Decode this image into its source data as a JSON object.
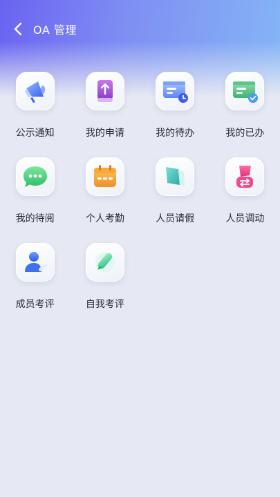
{
  "header": {
    "title": "OA 管理"
  },
  "menu": [
    {
      "label": "公示通知",
      "icon": "megaphone-icon"
    },
    {
      "label": "我的申请",
      "icon": "upload-book-icon"
    },
    {
      "label": "我的待办",
      "icon": "pending-tasks-icon"
    },
    {
      "label": "我的已办",
      "icon": "done-tasks-icon"
    },
    {
      "label": "我的待阅",
      "icon": "chat-bubble-icon"
    },
    {
      "label": "个人考勤",
      "icon": "calendar-icon"
    },
    {
      "label": "人员请假",
      "icon": "leave-flag-icon"
    },
    {
      "label": "人员调动",
      "icon": "transfer-icon"
    },
    {
      "label": "成员考评",
      "icon": "user-edit-icon"
    },
    {
      "label": "自我考评",
      "icon": "pen-icon"
    }
  ],
  "colors": {
    "header_start": "#6a63f2",
    "header_end": "#85b6f6",
    "background": "#e6e9f3"
  }
}
